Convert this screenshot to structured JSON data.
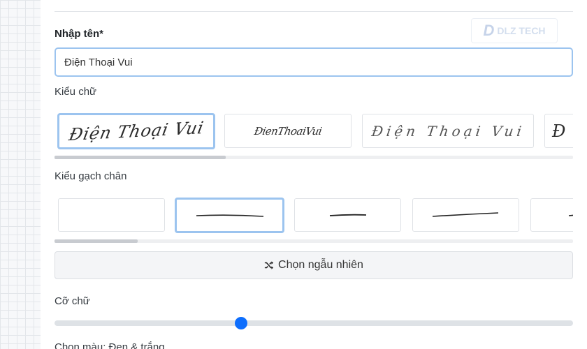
{
  "name_label": "Nhập tên*",
  "name_input": {
    "value": "Điện Thoại Vui",
    "placeholder": ""
  },
  "watermark": {
    "text": "DLZ TECH"
  },
  "font_label": "Kiểu chữ",
  "font_styles": [
    {
      "preview": "Điện Thoại Vui",
      "selected": true
    },
    {
      "preview": "ĐienThoaiVui",
      "selected": false
    },
    {
      "preview": "Điện Thoại Vui",
      "selected": false
    },
    {
      "preview": "Đ",
      "selected": false
    }
  ],
  "font_scroll": {
    "position": 0,
    "visible_fraction": 0.33
  },
  "underline_label": "Kiểu gạch chân",
  "underline_styles": [
    {
      "style": "none",
      "selected": false
    },
    {
      "style": "long-line",
      "selected": true
    },
    {
      "style": "short-line",
      "selected": false
    },
    {
      "style": "slanted-line",
      "selected": false
    },
    {
      "style": "tick",
      "selected": false
    }
  ],
  "underline_scroll": {
    "position": 0,
    "visible_fraction": 0.16
  },
  "random_button": {
    "label": "Chọn ngẫu nhiên",
    "icon": "shuffle-icon"
  },
  "size_label": "Cỡ chữ",
  "size_slider": {
    "value": 0.36
  },
  "color_label": "Chọn màu: Đen & trắng",
  "colors": {
    "accent": "#0d6efd",
    "selected_border": "#9cc4ef"
  }
}
